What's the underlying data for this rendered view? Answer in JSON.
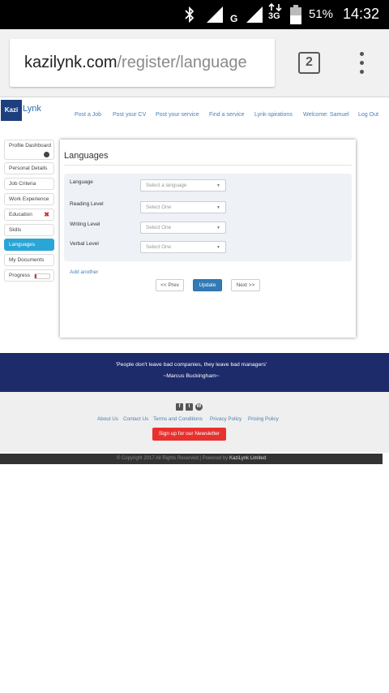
{
  "status_bar": {
    "battery_percent": "51%",
    "time": "14:32",
    "network_label": "3G",
    "carrier_glyph": "G",
    "icons": [
      "bluetooth-icon",
      "signal-icon",
      "signal-icon",
      "data-arrows-icon",
      "battery-icon"
    ]
  },
  "browser": {
    "url_domain": "kazilynk.com",
    "url_path": "/register/language",
    "tab_count": "2"
  },
  "site": {
    "logo_letter": "Kazi",
    "logo_suffix": "Lynk",
    "nav": [
      "Post a Job",
      "Post your CV",
      "Post your service",
      "Find a service",
      "Lynk-spirations",
      "Welcome: Samuel",
      "Log Out"
    ]
  },
  "sidebar": {
    "items": [
      "Profile Dashboard",
      "Personal Details",
      "Job Criteria",
      "Work Experience",
      "Education",
      "Skills",
      "Languages",
      "My Documents",
      "Progress"
    ],
    "active": "Languages",
    "progress_fraction": 0.1
  },
  "form": {
    "title": "Languages",
    "rows": [
      {
        "label": "Language",
        "placeholder": "Select a language"
      },
      {
        "label": "Reading Level",
        "placeholder": "Select One"
      },
      {
        "label": "Writing Level",
        "placeholder": "Select One"
      },
      {
        "label": "Verbal Level",
        "placeholder": "Select One"
      }
    ],
    "add_another": "Add another",
    "prev_label": "<< Prev",
    "update_label": "Update",
    "next_label": "Next >>"
  },
  "quote": {
    "text": "'People don't leave bad companies, they leave bad managers'",
    "author": "~Marcus Buckingham~"
  },
  "footer": {
    "social_icons": [
      "facebook-icon",
      "twitter-icon",
      "wordpress-icon"
    ],
    "links": [
      "About Us",
      "Contact Us",
      "Terms and Conditions",
      "Privacy Policy",
      "Pricing Policy"
    ],
    "newsletter_label": "Sign up for our Newsletter",
    "copyright": "© Copyright 2017 All Rights Reserved | Powered by",
    "copyright_brand": "KaziLynk Limited"
  },
  "colors": {
    "accent": "#29a5d6",
    "primary_button": "#337ab7",
    "quote_band": "#1d2b6b",
    "newsletter": "#e8312f",
    "logo": "#1d3f7e"
  }
}
